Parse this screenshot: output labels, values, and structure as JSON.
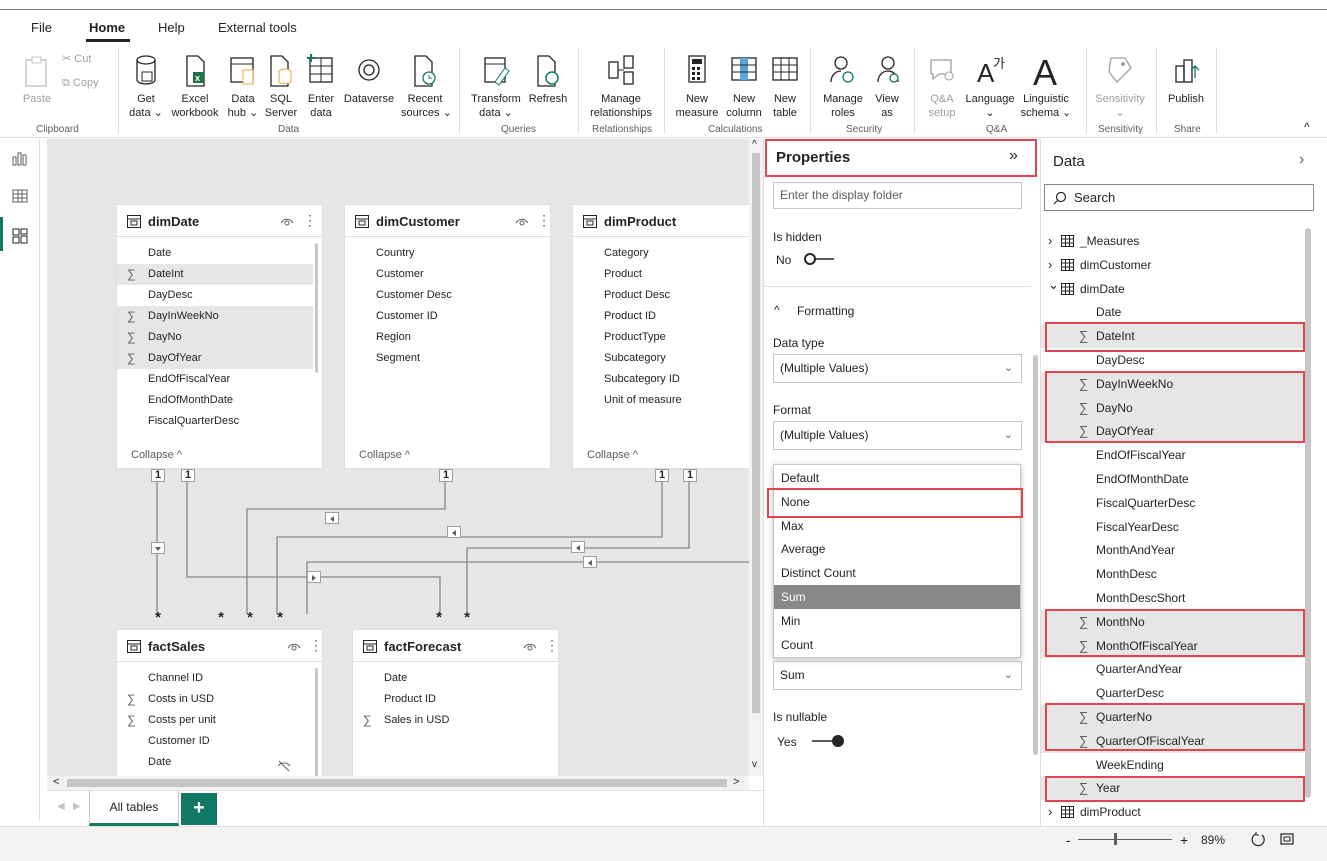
{
  "menu": {
    "file": "File",
    "home": "Home",
    "help": "Help",
    "external": "External tools"
  },
  "ribbon": {
    "paste": "Paste",
    "cut": "Cut",
    "copy": "Copy",
    "clipboard": "Clipboard",
    "get_data": [
      "Get",
      "data ⌄"
    ],
    "excel": [
      "Excel",
      "workbook"
    ],
    "data_hub": [
      "Data",
      "hub ⌄"
    ],
    "sql": [
      "SQL",
      "Server"
    ],
    "enter_data": [
      "Enter",
      "data"
    ],
    "dataverse": "Dataverse",
    "recent": [
      "Recent",
      "sources ⌄"
    ],
    "data_group": "Data",
    "transform": [
      "Transform",
      "data ⌄"
    ],
    "refresh": "Refresh",
    "queries": "Queries",
    "manage_rel": [
      "Manage",
      "relationships"
    ],
    "relationships": "Relationships",
    "new_measure": [
      "New",
      "measure"
    ],
    "new_column": [
      "New",
      "column"
    ],
    "new_table": [
      "New",
      "table"
    ],
    "calculations": "Calculations",
    "manage_roles": [
      "Manage",
      "roles"
    ],
    "view_as": [
      "View",
      "as"
    ],
    "security": "Security",
    "qa_setup": [
      "Q&A",
      "setup"
    ],
    "language": [
      "Language",
      "⌄"
    ],
    "linguistic": [
      "Linguistic",
      "schema ⌄"
    ],
    "qa": "Q&A",
    "sensitivity": [
      "Sensitivity",
      "⌄"
    ],
    "sensitivity_group": "Sensitivity",
    "publish": "Publish",
    "share": "Share"
  },
  "tables": {
    "dimDate": {
      "title": "dimDate",
      "fields": [
        {
          "name": "Date",
          "sum": false,
          "hl": false
        },
        {
          "name": "DateInt",
          "sum": true,
          "hl": true
        },
        {
          "name": "DayDesc",
          "sum": false,
          "hl": false
        },
        {
          "name": "DayInWeekNo",
          "sum": true,
          "hl": true
        },
        {
          "name": "DayNo",
          "sum": true,
          "hl": true
        },
        {
          "name": "DayOfYear",
          "sum": true,
          "hl": true
        },
        {
          "name": "EndOfFiscalYear",
          "sum": false,
          "hl": false
        },
        {
          "name": "EndOfMonthDate",
          "sum": false,
          "hl": false
        },
        {
          "name": "FiscalQuarterDesc",
          "sum": false,
          "hl": false
        }
      ]
    },
    "dimCustomer": {
      "title": "dimCustomer",
      "fields": [
        {
          "name": "Country",
          "sum": false
        },
        {
          "name": "Customer",
          "sum": false
        },
        {
          "name": "Customer Desc",
          "sum": false
        },
        {
          "name": "Customer ID",
          "sum": false
        },
        {
          "name": "Region",
          "sum": false
        },
        {
          "name": "Segment",
          "sum": false
        }
      ]
    },
    "dimProduct": {
      "title": "dimProduct",
      "fields": [
        {
          "name": "Category",
          "sum": false
        },
        {
          "name": "Product",
          "sum": false
        },
        {
          "name": "Product Desc",
          "sum": false
        },
        {
          "name": "Product ID",
          "sum": false
        },
        {
          "name": "ProductType",
          "sum": false
        },
        {
          "name": "Subcategory",
          "sum": false
        },
        {
          "name": "Subcategory ID",
          "sum": false
        },
        {
          "name": "Unit of measure",
          "sum": false
        }
      ]
    },
    "factSales": {
      "title": "factSales",
      "fields": [
        {
          "name": "Channel ID",
          "sum": false
        },
        {
          "name": "Costs in USD",
          "sum": true
        },
        {
          "name": "Costs per unit",
          "sum": true
        },
        {
          "name": "Customer ID",
          "sum": false
        },
        {
          "name": "Date",
          "sum": false
        }
      ]
    },
    "factForecast": {
      "title": "factForecast",
      "fields": [
        {
          "name": "Date",
          "sum": false
        },
        {
          "name": "Product ID",
          "sum": false
        },
        {
          "name": "Sales in USD",
          "sum": true
        }
      ]
    },
    "collapse": "Collapse ^"
  },
  "relationships": {
    "one": "1",
    "many": "*"
  },
  "tabs": {
    "all_tables": "All tables",
    "add": "+"
  },
  "properties": {
    "title": "Properties",
    "expand": "»",
    "display_folder_placeholder": "Enter the display folder",
    "is_hidden": "Is hidden",
    "is_hidden_value": "No",
    "formatting": "Formatting",
    "data_type": "Data type",
    "data_type_value": "(Multiple Values)",
    "format": "Format",
    "format_value": "(Multiple Values)",
    "summarize_options": [
      "Default",
      "None",
      "Max",
      "Average",
      "Distinct Count",
      "Sum",
      "Min",
      "Count"
    ],
    "summarize_selected": "Sum",
    "summarize_value": "Sum",
    "is_nullable": "Is nullable",
    "is_nullable_value": "Yes"
  },
  "data": {
    "title": "Data",
    "search_placeholder": "Search",
    "tree": [
      {
        "name": "_Measures",
        "level": 0,
        "table": true,
        "expanded": false
      },
      {
        "name": "dimCustomer",
        "level": 0,
        "table": true,
        "expanded": false
      },
      {
        "name": "dimDate",
        "level": 0,
        "table": true,
        "expanded": true
      },
      {
        "name": "Date",
        "level": 1,
        "sum": false,
        "hl": false
      },
      {
        "name": "DateInt",
        "level": 1,
        "sum": true,
        "hl": true
      },
      {
        "name": "DayDesc",
        "level": 1,
        "sum": false,
        "hl": false
      },
      {
        "name": "DayInWeekNo",
        "level": 1,
        "sum": true,
        "hl": true
      },
      {
        "name": "DayNo",
        "level": 1,
        "sum": true,
        "hl": true
      },
      {
        "name": "DayOfYear",
        "level": 1,
        "sum": true,
        "hl": true
      },
      {
        "name": "EndOfFiscalYear",
        "level": 1,
        "sum": false,
        "hl": false
      },
      {
        "name": "EndOfMonthDate",
        "level": 1,
        "sum": false,
        "hl": false
      },
      {
        "name": "FiscalQuarterDesc",
        "level": 1,
        "sum": false,
        "hl": false
      },
      {
        "name": "FiscalYearDesc",
        "level": 1,
        "sum": false,
        "hl": false
      },
      {
        "name": "MonthAndYear",
        "level": 1,
        "sum": false,
        "hl": false
      },
      {
        "name": "MonthDesc",
        "level": 1,
        "sum": false,
        "hl": false
      },
      {
        "name": "MonthDescShort",
        "level": 1,
        "sum": false,
        "hl": false
      },
      {
        "name": "MonthNo",
        "level": 1,
        "sum": true,
        "hl": true
      },
      {
        "name": "MonthOfFiscalYear",
        "level": 1,
        "sum": true,
        "hl": true
      },
      {
        "name": "QuarterAndYear",
        "level": 1,
        "sum": false,
        "hl": false
      },
      {
        "name": "QuarterDesc",
        "level": 1,
        "sum": false,
        "hl": false
      },
      {
        "name": "QuarterNo",
        "level": 1,
        "sum": true,
        "hl": true
      },
      {
        "name": "QuarterOfFiscalYear",
        "level": 1,
        "sum": true,
        "hl": true
      },
      {
        "name": "WeekEnding",
        "level": 1,
        "sum": false,
        "hl": false
      },
      {
        "name": "Year",
        "level": 1,
        "sum": true,
        "hl": true
      },
      {
        "name": "dimProduct",
        "level": 0,
        "table": true,
        "expanded": false
      }
    ]
  },
  "status": {
    "zoom_minus": "-",
    "zoom_plus": "+",
    "zoom": "89%"
  },
  "colors": {
    "accent": "#117865",
    "highlight": "#e2454e",
    "selected": "#8a8886"
  }
}
